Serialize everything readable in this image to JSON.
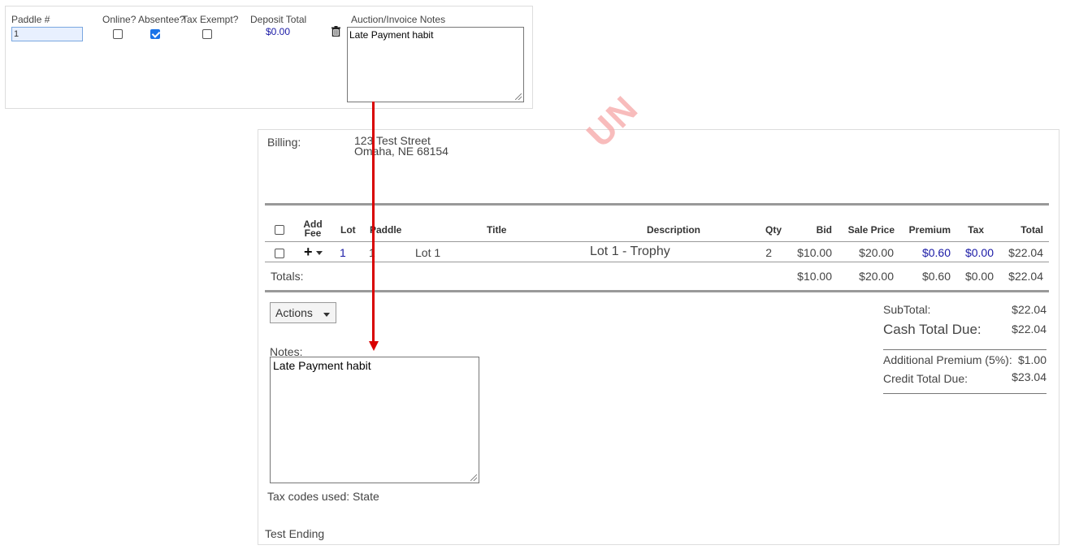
{
  "top": {
    "headers": {
      "paddle": "Paddle #",
      "online": "Online?",
      "absentee": "Absentee?",
      "tax_exempt": "Tax Exempt?",
      "deposit": "Deposit Total",
      "notes": "Auction/Invoice Notes"
    },
    "paddle_value": "1",
    "online": false,
    "absentee": true,
    "tax_exempt": false,
    "deposit_value": "$0.00",
    "notes_value": "Late Payment habit"
  },
  "main": {
    "watermark": "UN",
    "billing_label": "Billing:",
    "billing_line1": "123 Test Street",
    "billing_line2": "Omaha, NE 68154",
    "table": {
      "headers": {
        "add_fee_1": "Add",
        "add_fee_2": "Fee",
        "lot": "Lot",
        "paddle": "Paddle",
        "title": "Title",
        "description": "Description",
        "qty": "Qty",
        "bid": "Bid",
        "sale_price": "Sale Price",
        "premium": "Premium",
        "tax": "Tax",
        "total": "Total"
      },
      "row": {
        "lot": "1",
        "paddle": "1",
        "title": "Lot 1",
        "description": "Lot 1 - Trophy",
        "qty": "2",
        "bid": "$10.00",
        "sale_price": "$20.00",
        "premium": "$0.60",
        "tax": "$0.00",
        "total": "$22.04"
      },
      "totals": {
        "label": "Totals:",
        "bid": "$10.00",
        "sale_price": "$20.00",
        "premium": "$0.60",
        "tax": "$0.00",
        "total": "$22.04"
      }
    },
    "actions_label": "Actions",
    "summary": {
      "subtotal_label": "SubTotal:",
      "subtotal_value": "$22.04",
      "cash_label": "Cash Total Due:",
      "cash_value": "$22.04",
      "premium_label": "Additional Premium (5%):",
      "premium_value": "$1.00",
      "credit_label": "Credit Total Due:",
      "credit_value": "$23.04"
    },
    "notes_label": "Notes:",
    "notes_value": "Late Payment habit",
    "tax_codes": "Tax codes used: State",
    "footer": "Test Ending"
  },
  "colors": {
    "arrow": "#d90000",
    "link": "#1a1aa6",
    "checkbox": "#1a73e8"
  }
}
